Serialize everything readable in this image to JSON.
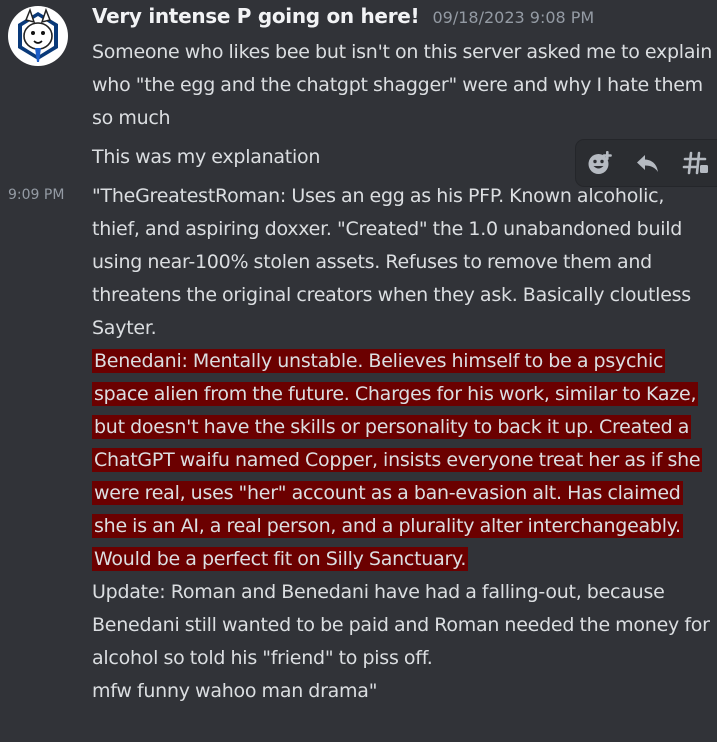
{
  "author": {
    "name": "Very intense P going on here!",
    "timestamp": "09/18/2023 9:08 PM"
  },
  "messages": [
    {
      "text": "Someone who likes bee but isn't on this server asked me to explain who \"the egg and the chatgpt shagger\" were and why I hate them so much"
    },
    {
      "text": "This was my explanation"
    },
    {
      "side_timestamp": "9:09 PM",
      "paragraphs": [
        {
          "text": "\"TheGreatestRoman: Uses an egg as his PFP. Known alcoholic, thief, and aspiring doxxer. \"Created\" the 1.0 unabandoned build using near-100% stolen assets. Refuses to remove them and threatens the original creators when they ask. Basically cloutless Sayter.",
          "highlighted": false
        },
        {
          "text": "Benedani: Mentally unstable. Believes himself to be a psychic space alien from the future. Charges for his work, similar to Kaze, but doesn't have the skills or personality to back it up. Created a ChatGPT waifu named Copper, insists everyone treat her as if she were real, uses \"her\" account as a ban-evasion alt. Has claimed she is an AI, a real person, and a plurality alter interchangeably. Would be a perfect fit on Silly Sanctuary.",
          "highlighted": true
        },
        {
          "text": "Update: Roman and Benedani have had a falling-out, because Benedani still wanted to be paid and Roman needed the money for alcohol so told his \"friend\" to piss off.",
          "highlighted": false
        },
        {
          "text": "mfw funny wahoo man drama\"",
          "highlighted": false
        }
      ]
    }
  ],
  "toolbar": {
    "icons": [
      "add-reaction-icon",
      "reply-icon",
      "create-thread-icon"
    ]
  },
  "colors": {
    "background": "#313338",
    "text": "#dbdee1",
    "muted": "#949ba4",
    "highlight": "#6b0000"
  }
}
